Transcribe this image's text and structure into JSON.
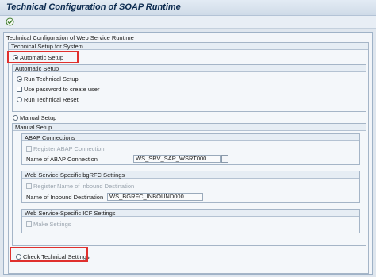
{
  "title": "Technical Configuration of SOAP Runtime",
  "toolbar": {
    "execute_icon": "execute-icon"
  },
  "main": {
    "group_title": "Technical Configuration of Web Service Runtime",
    "tech_setup_title": "Technical Setup for System",
    "automatic_setup_option": "Automatic Setup",
    "automatic_setup_section": "Automatic Setup",
    "run_technical_setup": "Run Technical Setup",
    "use_password": "Use password to create user",
    "run_technical_reset": "Run Technical Reset",
    "manual_setup_option": "Manual Setup",
    "manual_setup_section": "Manual Setup",
    "abap_connections": {
      "title": "ABAP Connections",
      "register_label": "Register ABAP Connection",
      "name_label": "Name of ABAP Connection",
      "name_value": "WS_SRV_SAP_WSRT000"
    },
    "bgrfc": {
      "title": "Web Service-Specific bgRFC Settings",
      "register_label": "Register Name of Inbound Destination",
      "name_label": "Name of Inbound Destination",
      "name_value": "WS_BGRFC_INBOUND000"
    },
    "icf": {
      "title": "Web Service-Specific ICF Settings",
      "make_settings": "Make Settings"
    },
    "check_technical_settings": "Check Technical Settings"
  }
}
